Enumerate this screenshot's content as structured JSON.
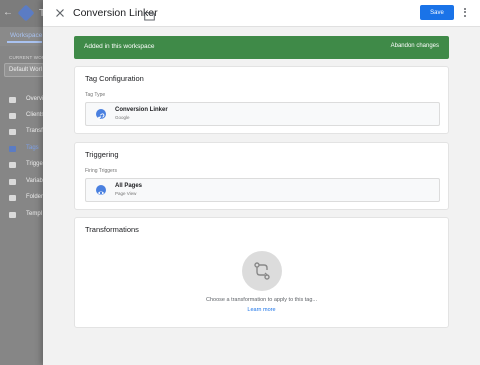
{
  "background": {
    "app_title_initial": "T",
    "tab": "Workspace",
    "current_workspace_label": "CURRENT WOR",
    "workspace_name": "Default Worl",
    "nav": [
      {
        "label": "Overvi",
        "active": false
      },
      {
        "label": "Clients",
        "active": false
      },
      {
        "label": "Transfo",
        "active": false
      },
      {
        "label": "Tags",
        "active": true
      },
      {
        "label": "Trigge",
        "active": false
      },
      {
        "label": "Variab",
        "active": false
      },
      {
        "label": "Folder",
        "active": false
      },
      {
        "label": "Templ",
        "active": false
      }
    ]
  },
  "panel": {
    "title": "Conversion Linker",
    "save_label": "Save",
    "banner": {
      "text": "Added in this workspace",
      "action": "Abandon changes",
      "color": "#3f8a48"
    },
    "tag_configuration": {
      "title": "Tag Configuration",
      "field_label": "Tag Type",
      "item_name": "Conversion Linker",
      "item_sub": "Google"
    },
    "triggering": {
      "title": "Triggering",
      "field_label": "Firing Triggers",
      "item_name": "All Pages",
      "item_sub": "Page View"
    },
    "transformations": {
      "title": "Transformations",
      "empty_text": "Choose a transformation to apply to this tag...",
      "learn_more": "Learn more"
    }
  },
  "colors": {
    "accent": "#1a73e8",
    "success": "#3f8a48"
  }
}
